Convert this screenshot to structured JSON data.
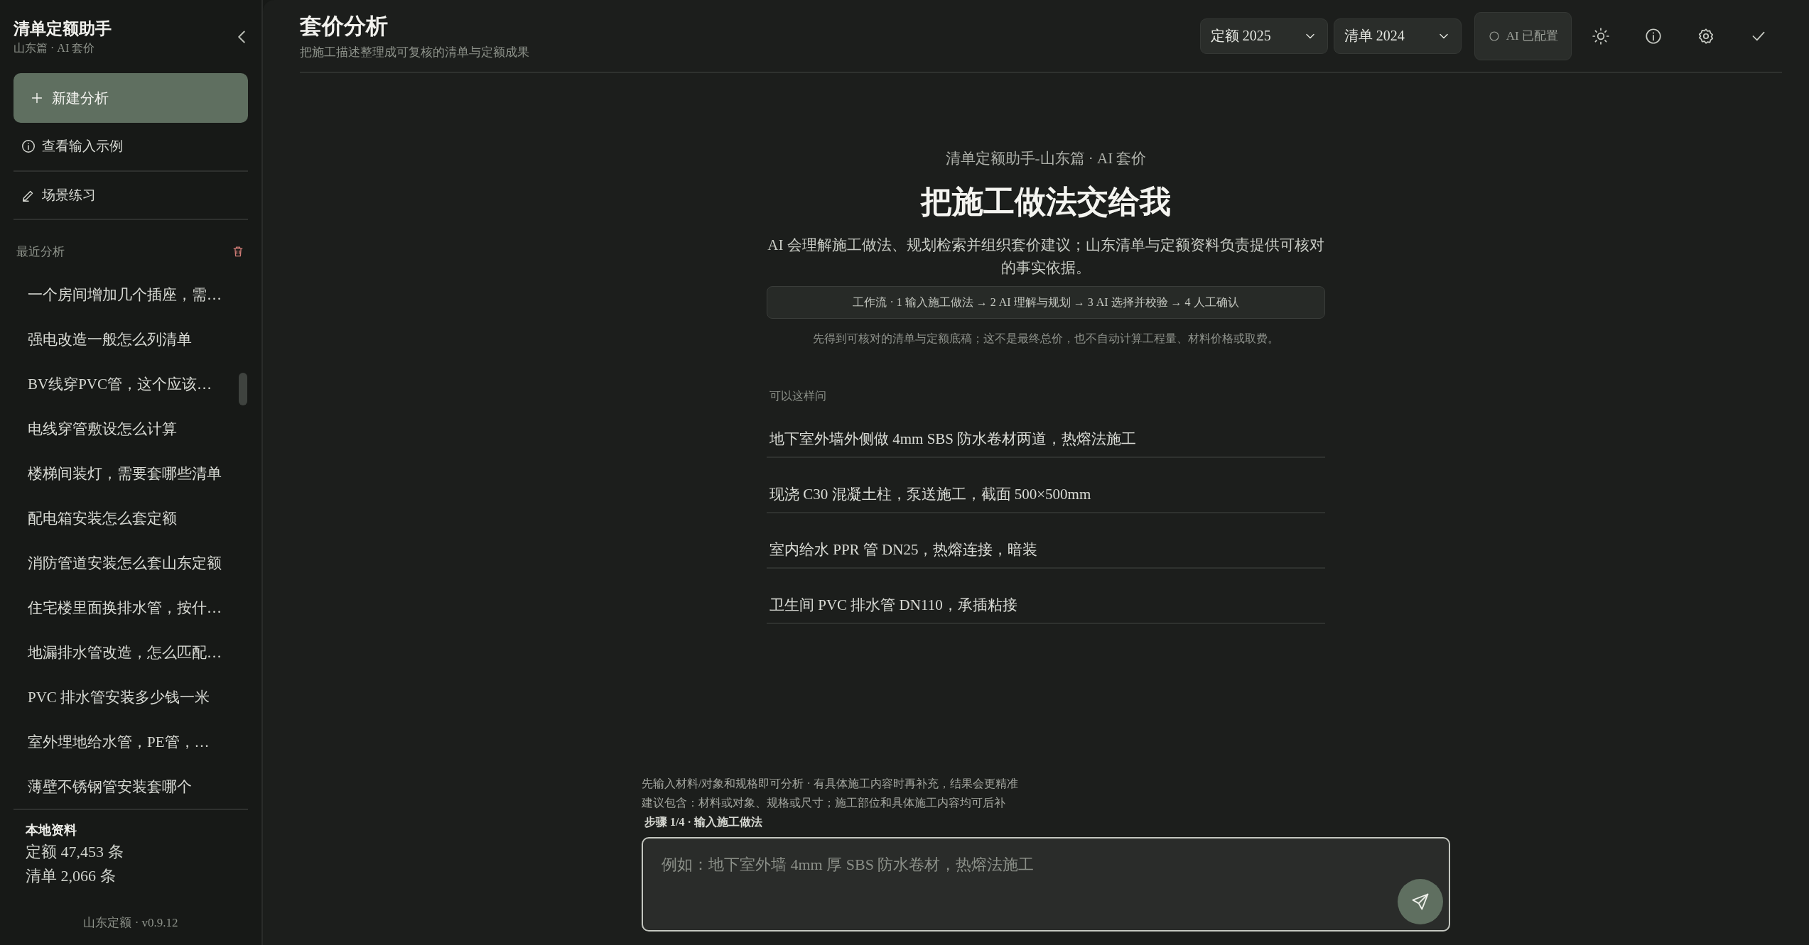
{
  "sidebar": {
    "title": "清单定额助手",
    "subtitle": "山东篇 · AI 套价",
    "new_button": "新建分析",
    "links": [
      {
        "kind": "info",
        "label": "查看输入示例"
      },
      {
        "kind": "edit",
        "label": "场景练习"
      }
    ],
    "recent_title": "最近分析",
    "recent": [
      "一个房间增加几个插座，需…",
      "强电改造一般怎么列清单",
      "BV线穿PVC管，这个应该…",
      "电线穿管敷设怎么计算",
      "楼梯间装灯，需要套哪些清单",
      "配电箱安装怎么套定额",
      "消防管道安装怎么套山东定额",
      "住宅楼里面换排水管，按什…",
      "地漏排水管改造，怎么匹配…",
      "PVC 排水管安装多少钱一米",
      "室外埋地给水管，PE管，…",
      "薄壁不锈钢管安装套哪个"
    ],
    "local": {
      "title": "本地资料",
      "lines": [
        "定额 47,453 条",
        "清单 2,066 条"
      ]
    },
    "version": "山东定额 · v0.9.12"
  },
  "header": {
    "title": "套价分析",
    "subtitle": "把施工描述整理成可复核的清单与定额成果",
    "selects": [
      {
        "value": "定额 2025"
      },
      {
        "value": "清单 2024"
      }
    ],
    "ai_status": "AI 已配置"
  },
  "hero": {
    "eyebrow": "清单定额助手-山东篇 · AI 套价",
    "title": "把施工做法交给我",
    "description": "AI 会理解施工做法、规划检索并组织套价建议；山东清单与定额资料负责提供可核对的事实依据。",
    "workflow": "工作流 · 1 输入施工做法 → 2 AI 理解与规划 → 3 AI 选择并校验 → 4 人工确认",
    "note": "先得到可核对的清单与定额底稿；这不是最终总价，也不自动计算工程量、材料价格或取费。"
  },
  "examples": {
    "title": "可以这样问",
    "items": [
      "地下室外墙外侧做 4mm SBS 防水卷材两道，热熔法施工",
      "现浇 C30 混凝土柱，泵送施工，截面 500×500mm",
      "室内给水 PPR 管 DN25，热熔连接，暗装",
      "卫生间 PVC 排水管 DN110，承插粘接"
    ]
  },
  "composer": {
    "hints": [
      "先输入材料/对象和规格即可分析 · 有具体施工内容时再补充，结果会更精准",
      "建议包含：材料或对象、规格或尺寸；施工部位和具体施工内容均可后补"
    ],
    "step": "步骤 1/4 · 输入施工做法",
    "placeholder": "例如：地下室外墙 4mm 厚 SBS 防水卷材，热熔法施工"
  }
}
